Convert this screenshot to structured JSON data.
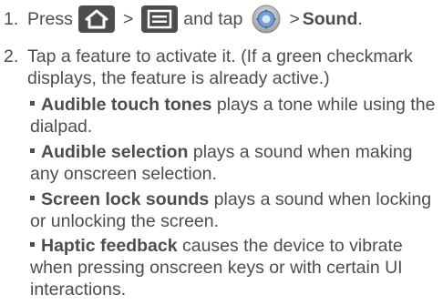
{
  "steps": [
    {
      "number": "1.",
      "press": "Press",
      "gt1": ">",
      "and_tap": "and tap",
      "gt2": ">",
      "target": "Sound",
      "end": "."
    },
    {
      "number": "2.",
      "text": "Tap a feature to activate it. (If a green checkmark displays, the feature is already active.)"
    }
  ],
  "features": [
    {
      "name": "Audible touch tones",
      "desc": " plays a tone while using the dialpad."
    },
    {
      "name": "Audible selection",
      "desc": " plays a sound when making any onscreen selection."
    },
    {
      "name": "Screen lock sounds",
      "desc": " plays a sound when locking or unlocking the screen."
    },
    {
      "name": "Haptic feedback",
      "desc": " causes the device to vibrate when pressing onscreen keys or with certain UI interactions."
    }
  ],
  "icons": {
    "home": "home-icon",
    "menu": "menu-icon",
    "settings": "settings-icon"
  },
  "colors": {
    "text": "#4d4d4d",
    "button_fill": "#4d4d4d",
    "icon_fill": "#ffffff"
  }
}
